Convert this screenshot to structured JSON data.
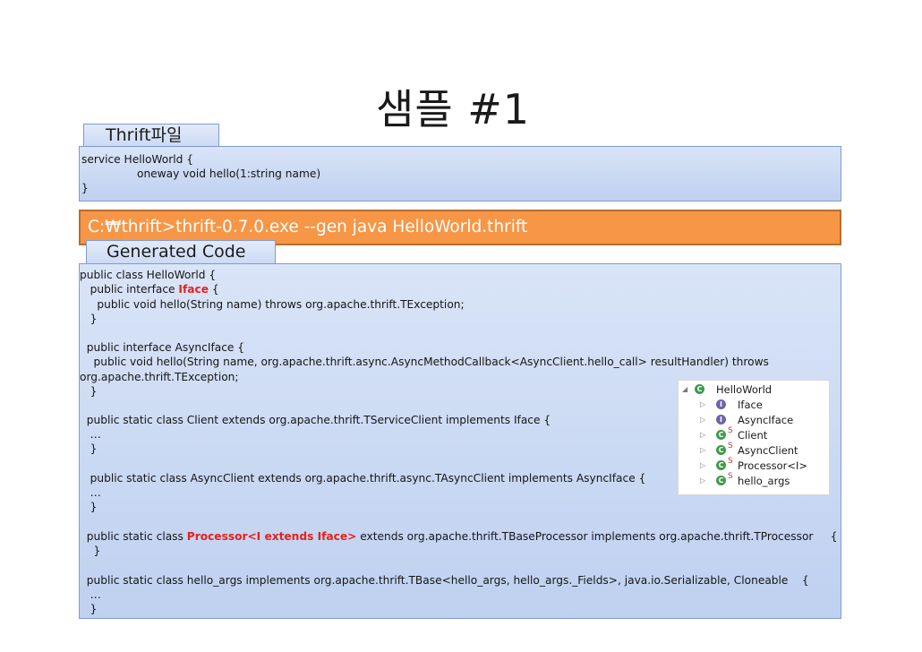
{
  "title": "샘플 #1",
  "thrift_file": {
    "tab_label": "Thrift파일",
    "lines": [
      "service HelloWorld {",
      "                oneway void hello(1:string name)",
      "}"
    ]
  },
  "command": "C:₩thrift>thrift-0.7.0.exe --gen java HelloWorld.thrift",
  "generated": {
    "tab_label": "Generated Code",
    "l1": "public class HelloWorld {",
    "l2a": "   public interface ",
    "l2b": "Iface",
    "l2c": " {",
    "l3": "     public void hello(String name) throws org.apache.thrift.TException;",
    "l4": "   }",
    "l5": "",
    "l6": "  public interface AsyncIface {",
    "l7": "    public void hello(String name, org.apache.thrift.async.AsyncMethodCallback<AsyncClient.hello_call> resultHandler) throws",
    "l8": "org.apache.thrift.TException;",
    "l9": "   }",
    "l10": "",
    "l11": "  public static class Client extends org.apache.thrift.TServiceClient implements Iface {",
    "l12": "   …",
    "l13": "   }",
    "l14": "",
    "l15": "   public static class AsyncClient extends org.apache.thrift.async.TAsyncClient implements AsyncIface {",
    "l16": "   …",
    "l17": "   }",
    "l18": "",
    "l19a": "  public static class ",
    "l19b": "Processor<I extends Iface>",
    "l19c": " extends org.apache.thrift.TBaseProcessor implements org.apache.thrift.TProcessor     {",
    "l20": "    }",
    "l21": "",
    "l22": "  public static class hello_args implements org.apache.thrift.TBase<hello_args, hello_args._Fields>, java.io.Serializable, Cloneable    {",
    "l23": "   …",
    "l24": "   }"
  },
  "outline": {
    "root": "HelloWorld",
    "items": [
      {
        "label": "Iface",
        "icon": "interface-icon",
        "static": ""
      },
      {
        "label": "AsyncIface",
        "icon": "interface-icon",
        "static": ""
      },
      {
        "label": "Client",
        "icon": "class-icon",
        "static": "S"
      },
      {
        "label": "AsyncClient",
        "icon": "class-icon",
        "static": "S"
      },
      {
        "label": "Processor<I>",
        "icon": "class-icon",
        "static": "S"
      },
      {
        "label": "hello_args",
        "icon": "class-icon",
        "static": "S"
      }
    ]
  },
  "colors": {
    "blue_box": "#c9d8f3",
    "command_bg": "#f79646",
    "highlight": "#e8201a"
  }
}
